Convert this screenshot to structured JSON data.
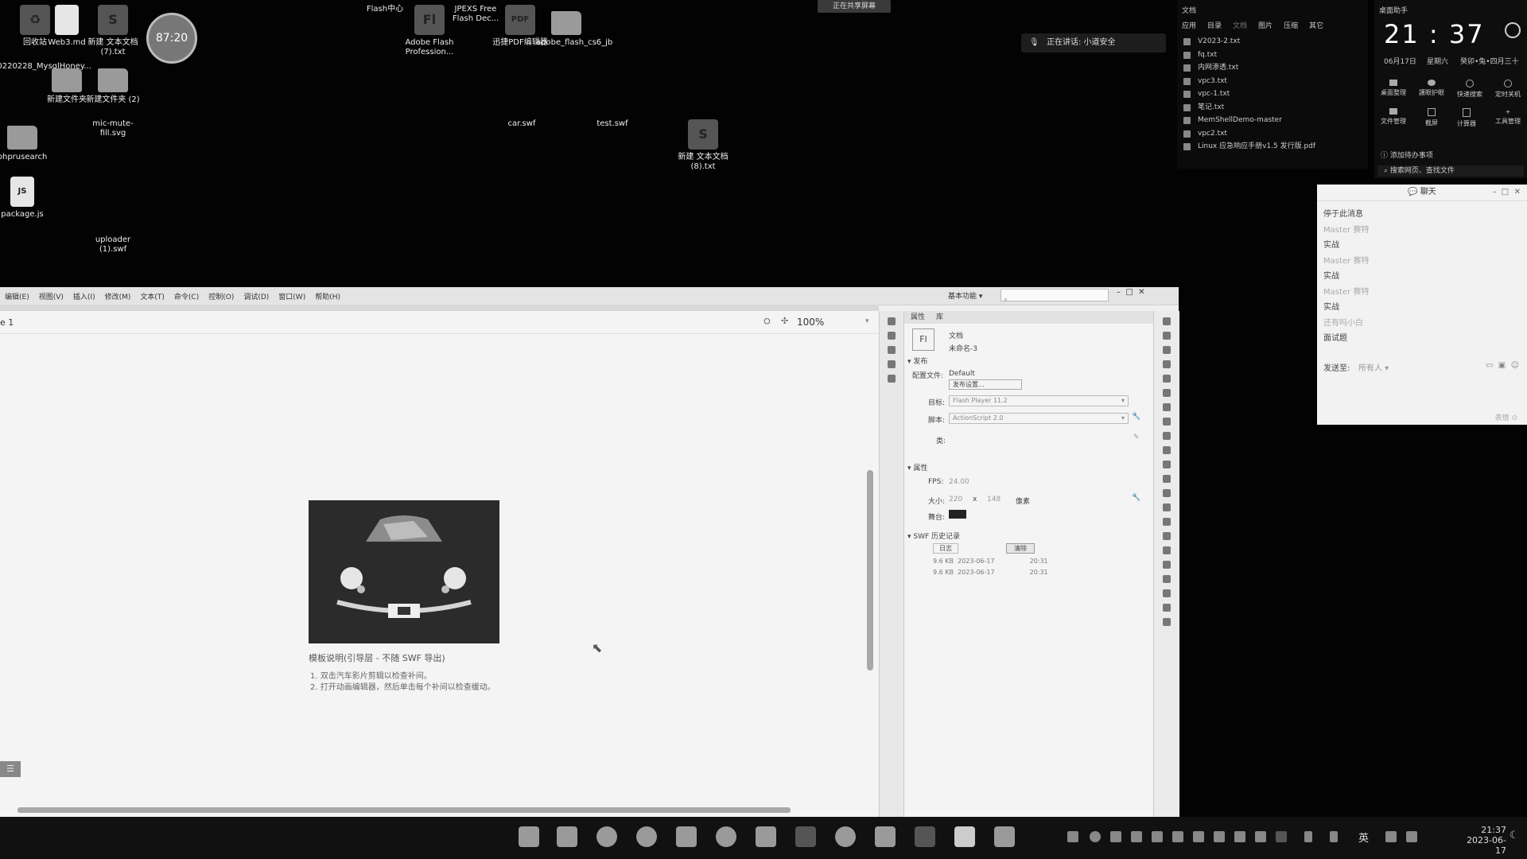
{
  "desktop": {
    "icons": [
      {
        "label": "回收站",
        "kind": "dark",
        "glyph": "♻"
      },
      {
        "label": "Web3.md",
        "kind": "file",
        "glyph": ""
      },
      {
        "label": "新建 文本文档 (7).txt",
        "kind": "dark",
        "glyph": "S"
      },
      {
        "label": "Flash中心",
        "kind": "flash",
        "glyph": "ƒ"
      },
      {
        "label": "Adobe Flash Profession...",
        "kind": "dark",
        "glyph": "Fl"
      },
      {
        "label": "JPEXS Free Flash Dec...",
        "kind": "flash",
        "glyph": "FF"
      },
      {
        "label": "迅捷PDF编辑器",
        "kind": "dark",
        "glyph": "PDF"
      },
      {
        "label": "adobe_flash_cs6_jb",
        "kind": "folder",
        "glyph": ""
      },
      {
        "label": "20220228_MysqlHoney...",
        "kind": "flash",
        "glyph": "ZIP"
      },
      {
        "label": "新建文件夹",
        "kind": "folder",
        "glyph": ""
      },
      {
        "label": "新建文件夹 (2)",
        "kind": "folder",
        "glyph": ""
      },
      {
        "label": "phprusearch",
        "kind": "folder",
        "glyph": ""
      },
      {
        "label": "mic-mute-fill.svg",
        "kind": "flash",
        "glyph": "○"
      },
      {
        "label": "car.swf",
        "kind": "flash",
        "glyph": "ƒ"
      },
      {
        "label": "test.swf",
        "kind": "flash",
        "glyph": "ƒ"
      },
      {
        "label": "新建 文本文档 (8).txt",
        "kind": "dark",
        "glyph": "S"
      },
      {
        "label": "package.js",
        "kind": "file",
        "glyph": "JS"
      },
      {
        "label": "uploader (1).swf",
        "kind": "flash",
        "glyph": "ƒ"
      }
    ],
    "timer_widget": "87:20"
  },
  "banner": "正在共享屏幕",
  "toast": {
    "text": "正在讲话: 小道安全",
    "icon": "mic-icon"
  },
  "file_panel": {
    "title": "文档",
    "tabs": [
      "应用",
      "目录",
      "文档",
      "图片",
      "压缩",
      "其它"
    ],
    "files": [
      "V2023-2.txt",
      "fq.txt",
      "内网渗透.txt",
      "vpc3.txt",
      "vpc-1.txt",
      "笔记.txt",
      "MemShellDemo-master",
      "vpc2.txt",
      "Linux 应急响应手册v1.5 发行版.pdf"
    ]
  },
  "widget": {
    "title": "桌面助手",
    "time": "21 : 37",
    "date": "06月17日",
    "weekday": "星期六",
    "lunar": "癸卯•兔•四月三十",
    "actions_row1": [
      "桌面整理",
      "護眼护眼",
      "快速搜索",
      "定时关机"
    ],
    "actions_row2": [
      "文件管理",
      "截屏",
      "计算器",
      "工具管理"
    ],
    "add_todo": "添加待办事项",
    "search_placeholder": "搜索网页、查找文件"
  },
  "chat": {
    "title": "聊天",
    "messages": [
      {
        "text": "停于此消息",
        "muted": false
      },
      {
        "text": "Master 赛特",
        "muted": true
      },
      {
        "text": "实战",
        "muted": false
      },
      {
        "text": "Master 赛特",
        "muted": true
      },
      {
        "text": "实战",
        "muted": false
      },
      {
        "text": "Master 赛特",
        "muted": true
      },
      {
        "text": "实战",
        "muted": false
      },
      {
        "text": "还有吗小白",
        "muted": true
      },
      {
        "text": "面试题",
        "muted": false
      }
    ],
    "send_to_label": "发送至:",
    "send_to_value": "所有人",
    "footer": "表情 ⊙"
  },
  "flash": {
    "menu": [
      "编辑(E)",
      "视图(V)",
      "插入(I)",
      "修改(M)",
      "文本(T)",
      "命令(C)",
      "控制(O)",
      "调试(D)",
      "窗口(W)",
      "帮助(H)"
    ],
    "workspace": "基本功能",
    "scene": "e 1",
    "zoom": "100%",
    "template_title": "模板说明(引导层 - 不随 SWF 导出)",
    "template_line1": "1. 双击汽车影片剪辑以检查补间。",
    "template_line2": "2. 打开动画编辑器，然后单击每个补间以检查缓动。",
    "props": {
      "tab1": "属性",
      "tab2": "库",
      "doc_label": "文档",
      "doc_name": "未命名-3",
      "publish_section": "发布",
      "profile_label": "配置文件:",
      "profile_value": "Default",
      "publish_settings_btn": "发布设置...",
      "target_label": "目标:",
      "target_value": "Flash Player 11.2",
      "script_label": "脚本:",
      "script_value": "ActionScript 2.0",
      "class_label": "类:",
      "props_section": "属性",
      "fps_label": "FPS:",
      "fps_value": "24.00",
      "size_label": "大小:",
      "width": "220",
      "x": "x",
      "height": "148",
      "unit": "像素",
      "stage_label": "舞台:",
      "history_section": "SWF 历史记录",
      "log_btn": "日志",
      "clear_btn": "清除",
      "history": [
        {
          "size": "9.6 KB",
          "date": "2023-06-17",
          "time": "20:31"
        },
        {
          "size": "9.6 KB",
          "date": "2023-06-17",
          "time": "20:31"
        }
      ]
    }
  },
  "taskbar": {
    "lang": "英",
    "time": "21:37",
    "date": "2023-06-17"
  },
  "colors": {
    "desktop_bg": "#030303",
    "taskbar_bg": "#111111",
    "stage_bg": "#f4f4f4"
  }
}
